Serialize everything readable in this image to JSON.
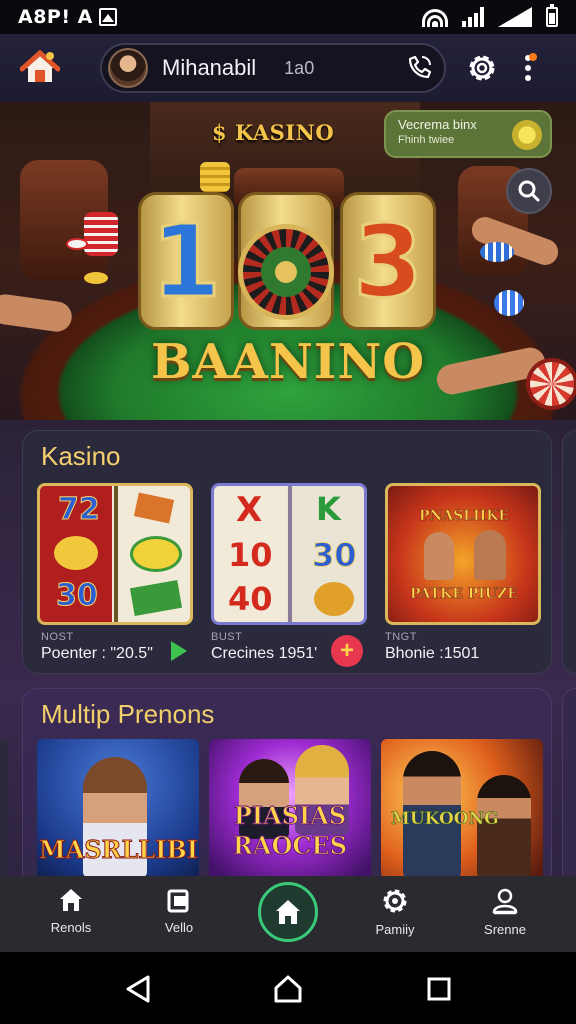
{
  "status_bar": {
    "carrier": "A8P! A"
  },
  "header": {
    "username": "Mihanabil",
    "score": "1a0"
  },
  "hero": {
    "top_label": "KASINO",
    "welcome": {
      "line1": "Vecrema binx",
      "line2": "Fhinh twiee"
    },
    "reel_left": "1",
    "reel_right": "3",
    "title": "BAANINO"
  },
  "kasino_section": {
    "title": "Kasino",
    "games": [
      {
        "tag": "NOST",
        "label": "Poenter : \"20.5\""
      },
      {
        "tag": "BUST",
        "label": "Crecines 1951'"
      },
      {
        "tag": "TNGT",
        "label": "Bhonie :1501"
      }
    ],
    "card_symbols": {
      "card1": [
        "72",
        "30"
      ],
      "card2": [
        "X",
        "10",
        "40",
        "K",
        "30"
      ],
      "card3": [
        "PNASLIIKE",
        "PATKE PIUZE"
      ]
    }
  },
  "multi_section": {
    "title": "Multip Prenons",
    "promos": [
      "MASRLLIBI",
      "PIASIAS RAOCES",
      "MUKOONG"
    ]
  },
  "bottom_nav": {
    "items": [
      "Renols",
      "Vello",
      "Pamiiy",
      "Srenne"
    ]
  },
  "colors": {
    "accent_gold": "#f4c54a",
    "nav_active": "#3ec97a",
    "add_button": "#e8384f",
    "play_green": "#3ec24f"
  }
}
